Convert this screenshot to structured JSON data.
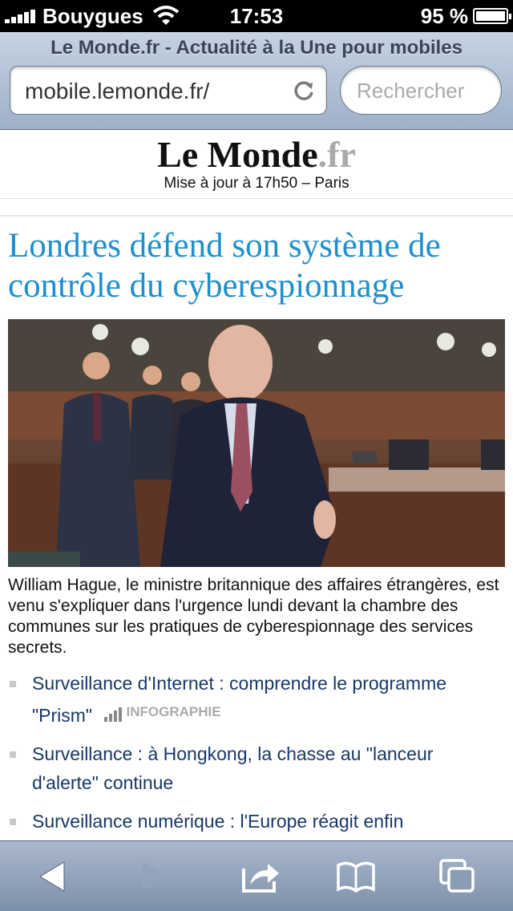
{
  "status_bar": {
    "carrier": "Bouygues",
    "time": "17:53",
    "battery": "95 %"
  },
  "browser": {
    "page_title": "Le Monde.fr - Actualité à la Une pour mobiles",
    "url": "mobile.lemonde.fr/",
    "search_placeholder": "Rechercher"
  },
  "site": {
    "logo_main": "Le Monde",
    "logo_ext": ".fr",
    "update": "Mise à jour à 17h50 – Paris"
  },
  "article": {
    "headline": "Londres défend son système de contrôle du cyberespionnage",
    "caption": "William Hague, le ministre britannique des affaires étrangères, est venu s'expliquer dans l'urgence lundi devant la chambre des communes sur les pratiques de cyberespionnage des services secrets."
  },
  "related": [
    {
      "label": "Surveillance d'Internet : comprendre le programme \"Prism\"",
      "tag": "INFOGRAPHIE"
    },
    {
      "label": "Surveillance : à Hongkong, la chasse au \"lanceur d'alerte\" continue"
    },
    {
      "label": "Surveillance numérique : l'Europe réagit enfin"
    }
  ],
  "toolbar": {
    "icons": [
      "back-icon",
      "forward-icon",
      "share-icon",
      "bookmarks-icon",
      "tabs-icon"
    ]
  },
  "colors": {
    "headline": "#1e8fcc",
    "link": "#16386a",
    "toolbar": "#8a9cb4"
  }
}
